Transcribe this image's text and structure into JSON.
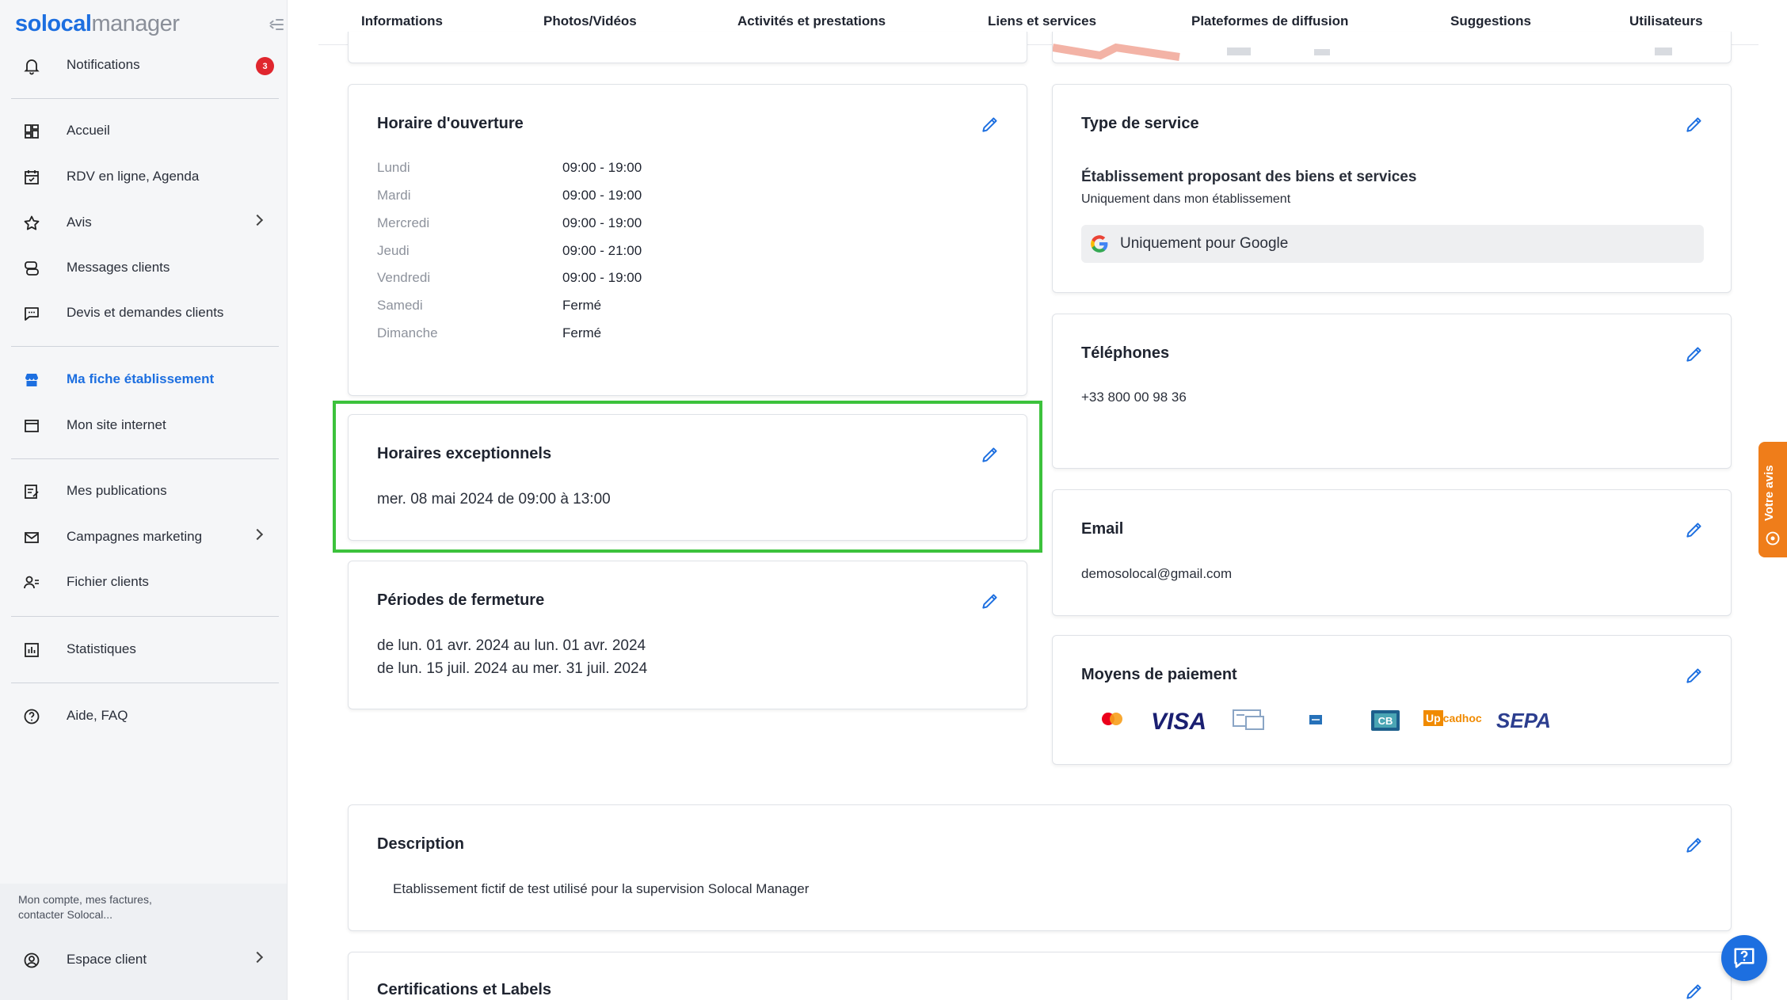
{
  "brand": {
    "part1": "solocal",
    "part2": "manager",
    "accent": "#1d6fe0"
  },
  "sidebar": {
    "items": [
      {
        "label": "Notifications",
        "icon": "bell-icon",
        "badge": "3"
      },
      {
        "label": "Accueil",
        "icon": "dashboard-icon"
      },
      {
        "label": "RDV en ligne, Agenda",
        "icon": "calendar-icon"
      },
      {
        "label": "Avis",
        "icon": "star-icon"
      },
      {
        "label": "Messages clients",
        "icon": "messages-icon"
      },
      {
        "label": "Devis et demandes clients",
        "icon": "chat-icon"
      },
      {
        "label": "Ma fiche établissement",
        "icon": "store-icon"
      },
      {
        "label": "Mon site internet",
        "icon": "website-icon"
      },
      {
        "label": "Mes publications",
        "icon": "publication-icon"
      },
      {
        "label": "Campagnes marketing",
        "icon": "mail-icon"
      },
      {
        "label": "Fichier clients",
        "icon": "contacts-icon"
      },
      {
        "label": "Statistiques",
        "icon": "stats-icon"
      },
      {
        "label": "Aide, FAQ",
        "icon": "help-icon"
      }
    ],
    "footer_text": "Mon compte, mes factures, contacter Solocal...",
    "client_space": "Espace client"
  },
  "tabs": [
    "Informations",
    "Photos/Vidéos",
    "Activités et prestations",
    "Liens et services",
    "Plateformes de diffusion",
    "Suggestions",
    "Utilisateurs"
  ],
  "opening_hours": {
    "title": "Horaire d'ouverture",
    "days": [
      {
        "day": "Lundi",
        "hours": "09:00 - 19:00"
      },
      {
        "day": "Mardi",
        "hours": "09:00 - 19:00"
      },
      {
        "day": "Mercredi",
        "hours": "09:00 - 19:00"
      },
      {
        "day": "Jeudi",
        "hours": "09:00 - 21:00"
      },
      {
        "day": "Vendredi",
        "hours": "09:00 - 19:00"
      },
      {
        "day": "Samedi",
        "hours": "Fermé"
      },
      {
        "day": "Dimanche",
        "hours": "Fermé"
      }
    ]
  },
  "exceptional_hours": {
    "title": "Horaires exceptionnels",
    "entry": "mer. 08 mai 2024 de 09:00 à 13:00"
  },
  "closing_periods": {
    "title": "Périodes de fermeture",
    "entries": [
      "de lun. 01 avr. 2024 au lun. 01 avr. 2024",
      "de lun. 15 juil. 2024 au mer. 31 juil. 2024"
    ]
  },
  "service_type": {
    "title": "Type de service",
    "heading": "Établissement proposant des biens et services",
    "sub": "Uniquement dans mon établissement",
    "google_note": "Uniquement pour Google"
  },
  "phones": {
    "title": "Téléphones",
    "value": "+33 800 00 98 36"
  },
  "email": {
    "title": "Email",
    "value": "demosolocal@gmail.com"
  },
  "payment": {
    "title": "Moyens de paiement",
    "methods": [
      "mastercard-icon",
      "visa-icon",
      "cheque-icon",
      "amex-icon",
      "cb-icon",
      "upcadhoc-icon",
      "sepa-icon"
    ],
    "visa": "VISA",
    "cb": "CB",
    "up": "Up",
    "cadhoc": "cadhoc",
    "sepa": "SEPA"
  },
  "description": {
    "title": "Description",
    "text": "Etablissement fictif de test utilisé pour la supervision Solocal Manager"
  },
  "certifications": {
    "title": "Certifications et Labels"
  },
  "feedback_tab": "Votre avis"
}
